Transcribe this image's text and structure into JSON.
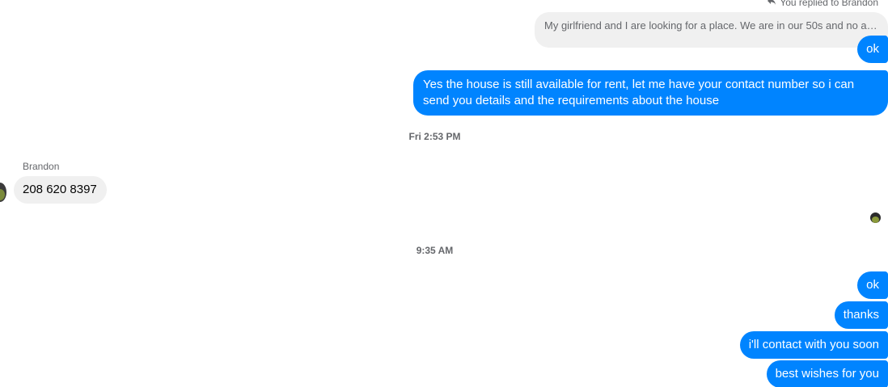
{
  "reply_header": {
    "label": "You replied to Brandon",
    "icon": "reply-arrow-icon"
  },
  "quoted_message": {
    "text": "My girlfriend and I are looking for a place. We are in our 50s and no an..."
  },
  "outgoing_group_1": [
    {
      "text": "ok"
    },
    {
      "text": "Yes the house is still available for rent, let me have your contact number so i can send you details and the requirements about the house"
    }
  ],
  "timestamps": {
    "first": "Fri 2:53 PM",
    "second": "9:35 AM"
  },
  "incoming": {
    "sender": "Brandon",
    "text": "208 620 8397"
  },
  "outgoing_group_2": [
    {
      "text": "ok"
    },
    {
      "text": "thanks"
    },
    {
      "text": "i'll contact with you soon"
    },
    {
      "text": "best wishes for you"
    }
  ],
  "colors": {
    "outgoing_bubble": "#0084ff",
    "incoming_bubble": "#f0f0f0",
    "meta_text": "#65676b"
  }
}
